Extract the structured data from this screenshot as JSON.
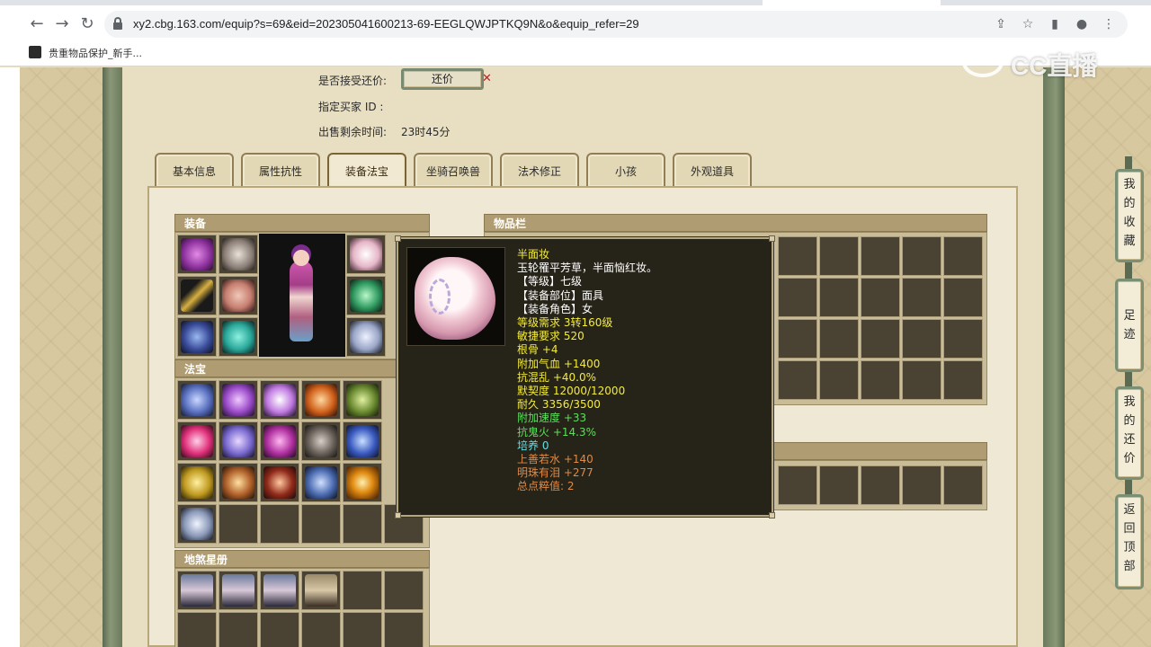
{
  "browser": {
    "url": "xy2.cbg.163.com/equip?s=69&eid=202305041600213-69-EEGLQWJPTKQ9N&o&equip_refer=29",
    "bookmark_label": "贵重物品保护_新手...",
    "watermark": "CC直播",
    "back_icon": "arrow-left-icon",
    "forward_icon": "arrow-right-icon",
    "reload_icon": "reload-icon"
  },
  "info": {
    "accept_counter_label": "是否接受还价:",
    "counter_button": "还价",
    "buyer_id_label": "指定买家 ID :",
    "remaining_label": "出售剩余时间:",
    "remaining_value": "23时45分"
  },
  "tabs": [
    {
      "label": "基本信息",
      "active": false
    },
    {
      "label": "属性抗性",
      "active": false
    },
    {
      "label": "装备法宝",
      "active": true
    },
    {
      "label": "坐骑召唤兽",
      "active": false
    },
    {
      "label": "法术修正",
      "active": false
    },
    {
      "label": "小孩",
      "active": false
    },
    {
      "label": "外观道具",
      "active": false
    }
  ],
  "sections": {
    "equipment": "装备",
    "treasure": "法宝",
    "star_book": "地煞星册",
    "inventory": "物品栏"
  },
  "tooltip": {
    "lines": [
      {
        "text": "半面妆",
        "color": "yellow"
      },
      {
        "text": "玉轮罹平芳草，半面恼红妆。",
        "color": "white"
      },
      {
        "text": "【等级】七级",
        "color": "white"
      },
      {
        "text": "【装备部位】面具",
        "color": "white"
      },
      {
        "text": "【装备角色】女",
        "color": "white"
      },
      {
        "text": "等级需求 3转160级",
        "color": "yellow"
      },
      {
        "text": "敏捷要求 520",
        "color": "yellow"
      },
      {
        "text": "根骨 +4",
        "color": "yellow"
      },
      {
        "text": "附加气血 +1400",
        "color": "yellow"
      },
      {
        "text": "抗混乱 +40.0%",
        "color": "yellow"
      },
      {
        "text": "默契度 12000/12000",
        "color": "yellow"
      },
      {
        "text": "耐久 3356/3500",
        "color": "yellow"
      },
      {
        "text": "附加速度 +33",
        "color": "green"
      },
      {
        "text": "抗鬼火 +14.3%",
        "color": "green"
      },
      {
        "text": "培养 0",
        "color": "cyan"
      },
      {
        "text": "上善若水 +140",
        "color": "orange"
      },
      {
        "text": "明珠有泪 +277",
        "color": "orange"
      },
      {
        "text": "总点粹值: 2",
        "color": "orange"
      }
    ]
  },
  "side_buttons": [
    {
      "label": "我的收藏",
      "chars": [
        "我",
        "的",
        "收",
        "藏"
      ]
    },
    {
      "label": "足迹",
      "chars": [
        "足",
        "迹"
      ]
    },
    {
      "label": "我的还价",
      "chars": [
        "我",
        "的",
        "还",
        "价"
      ]
    },
    {
      "label": "返回顶部",
      "chars": [
        "返",
        "回",
        "顶",
        "部"
      ]
    }
  ],
  "colors": {
    "tooltip_bg": "#262318",
    "accent_yellow": "#f4ec3a",
    "accent_green": "#5ce05c",
    "accent_cyan": "#5fe0e8",
    "accent_orange": "#e08a46",
    "section_header": "#b09c72"
  }
}
